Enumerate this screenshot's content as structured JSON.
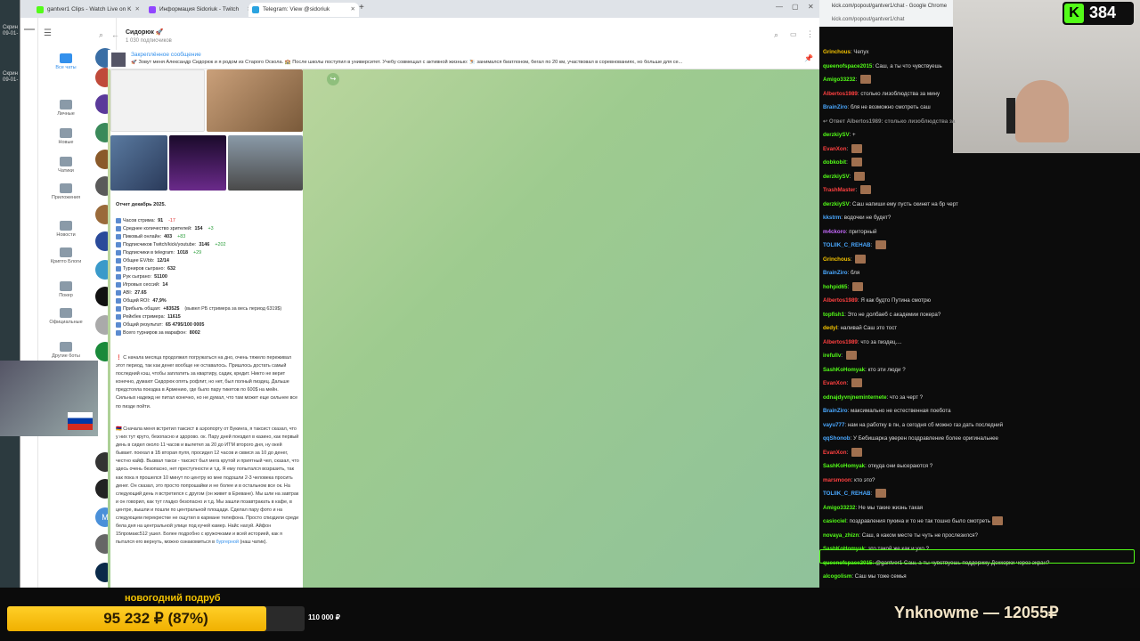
{
  "desktop": {
    "label1": "Скрин",
    "label2": "09-01-",
    "label3": "Скрин",
    "label4": "09-01-"
  },
  "browser": {
    "tabs": [
      {
        "label": "gantver1 Clips - Watch Live on K",
        "fav_color": "#53fc18"
      },
      {
        "label": "Информация Sidoriuk - Twitch",
        "fav_color": "#9146ff"
      },
      {
        "label": "Telegram: View @sidoriuk",
        "fav_color": "#2aa3e0"
      }
    ],
    "new_tab": "+",
    "win_min": "—",
    "win_max": "▢",
    "win_close": "✕"
  },
  "telegram": {
    "folders": [
      {
        "label": "Все чаты",
        "count": "90"
      },
      {
        "label": "Личные",
        "count": ""
      },
      {
        "label": "Новые",
        "count": "41"
      },
      {
        "label": "Чатики",
        "count": "1"
      },
      {
        "label": "Приложения",
        "count": ""
      },
      {
        "label": "Новости",
        "count": "6"
      },
      {
        "label": "Крипто Блоги",
        "count": "6"
      },
      {
        "label": "Покер",
        "count": "2"
      },
      {
        "label": "Официальные",
        "count": "6"
      },
      {
        "label": "Другие боты",
        "count": "5"
      }
    ],
    "channel_name": "Сидорюк 🚀",
    "subscribers": "1 030 подписчиков",
    "pinned_title": "Закреплённое сообщение",
    "pinned_text": "🚀 Зовут меня Александр Сидорюк и я родом из Старого Оскола. 🏫 После школы поступил в университет. Учебу совмещал с активной жизнью: ⛷️ занимался биатлоном, бегал по 20 км, участвовал в соревнованиях, но больше для се...",
    "report_title": "Отчет декабрь 2025.",
    "stats": [
      {
        "label": "Часов стрима:",
        "value": "91",
        "delta": "-17"
      },
      {
        "label": "Среднее количество зрителей:",
        "value": "154",
        "delta": "+3"
      },
      {
        "label": "Пиковый онлайн:",
        "value": "403",
        "delta": "+83"
      },
      {
        "label": "Подписчиков Twitch/kick/youtube:",
        "value": "3146",
        "delta": "+202"
      },
      {
        "label": "Подписчики в telegram:",
        "value": "1018",
        "delta": "+29"
      },
      {
        "label": "Общее EV/bb:",
        "value": "12/14",
        "delta": ""
      },
      {
        "label": "Турниров сыграно:",
        "value": "632",
        "delta": ""
      },
      {
        "label": "Рук сыграно:",
        "value": "51100",
        "delta": ""
      },
      {
        "label": "Игровых сессий:",
        "value": "14",
        "delta": ""
      },
      {
        "label": "ABI:",
        "value": "27.65",
        "delta": ""
      },
      {
        "label": "Общий ROI:",
        "value": "47,9%",
        "delta": ""
      },
      {
        "label": "Прибыль общая:",
        "value": "+8352$",
        "delta": "(вывел РБ стримера за весь период 6319$)"
      },
      {
        "label": "Рейкбек стримера:",
        "value": "11615",
        "delta": ""
      },
      {
        "label": "Общий результат:",
        "value": "65 4795/100 0005",
        "delta": ""
      },
      {
        "label": "Всего турниров за марафон:",
        "value": "8002",
        "delta": ""
      }
    ],
    "para1": "❗ С начала месяца продолжил погружаться на дно, очень тяжело переживал этот период, так как денег вообще не оставалось. Пришлось достать самый последний кэш, чтобы заплатить за квартиру, садик, кредит. Никто не верит конечно, думают Сидорюк опять рофлит, но нет, был полный пиздец. Дальше предстояла поездка в Армению, где было пару тикетов по 600$ на мейн. Сильных надежд не питал конечно, но не думал, что там может еще сильнее все по пизде пойти.",
    "para2": "🇦🇲 Сначала меня встретил таксист в аэропорту от Букинга, я таксист сказал, что у них тут круто, безопасно и здорово. ок. Пару дней поездил в казино, как первый день в сидел около 11 часов и вылетел за 20 до ИТМ второго дня, ну окей бывает. поехал в 1Б вторая пуля, просидел 12 часов и сквися за 10 до денег, честно кайф. Вызвал такси - таксист был мега крутой и приятный чел, сказал, что здесь очень безопасно, нет преступности и т.д. Я ему попытался возразить, так как пока я прошелся 10 минут по центру ко мне подошли 2-3 человека просить денег. Он сказал, это просто попрошайки и не более и в остальном все ок. На следующий день я встретился с другом (он живет в Ереване). Мы шли на завтрак и он говорил, как тут гладко безопасно и т.д. Мы зашли позавтракать в кафе, в центре, вышли и пошли по центральной площади. Сделал пару фото и на следующем перекрестке не ощутил в кармане телефона. Просто спиздили среди бела дня на центральной улице под кучей камер. Найс нахуй. Айфон 15промакс512 ушел. Более подробно с кружочками и всей историей, как я пытался его вернуть, можно ознакомиться в ",
    "para2_link": "бургерной",
    "para2_tail": " (наш чатик)."
  },
  "kick": {
    "window_title": "kick.com/popout/gantver1/chat - Google Chrome",
    "url": "kick.com/popout/gantver1/chat",
    "viewers": "384",
    "messages": [
      {
        "user": "Grinchous",
        "color": "#f5c400",
        "text": "Чепух"
      },
      {
        "user": "queenofspace2015",
        "color": "#53fc18",
        "text": "Саш, а ты что чувствуешь"
      },
      {
        "user": "Amigo33232",
        "color": "#53fc18",
        "text": "",
        "emote": true
      },
      {
        "user": "Albertos1989",
        "color": "#ff4040",
        "text": "столько лизоблюдства за мину"
      },
      {
        "user": "BrainZiro",
        "color": "#4aa8ff",
        "text": "бля не возможно смотреть саш"
      },
      {
        "user": "↩ Ответ Albertos1989: столько лизоблюдства за",
        "color": "#888",
        "text": ""
      },
      {
        "user": "derzkiySV",
        "color": "#53fc18",
        "text": "+"
      },
      {
        "user": "EvanXon",
        "color": "#ff4040",
        "text": "",
        "emote": true
      },
      {
        "user": "dobkobit",
        "color": "#53fc18",
        "text": "",
        "emote": true
      },
      {
        "user": "derzkiySV",
        "color": "#53fc18",
        "text": "",
        "emote": true
      },
      {
        "user": "TrashMaster",
        "color": "#ff4040",
        "text": "",
        "emote": true
      },
      {
        "user": "derzkiySV",
        "color": "#53fc18",
        "text": "Саш напиши ему пусть скинет на бр черт"
      },
      {
        "user": "kkstrm",
        "color": "#4aa8ff",
        "text": "водочки не будет?"
      },
      {
        "user": "m4ckoro",
        "color": "#c86bff",
        "text": "приторный"
      },
      {
        "user": "TOLIIK_C_REHAB",
        "color": "#4aa8ff",
        "text": "",
        "emote": true
      },
      {
        "user": "Grinchous",
        "color": "#f5c400",
        "text": "",
        "emote": true
      },
      {
        "user": "BrainZiro",
        "color": "#4aa8ff",
        "text": "бля"
      },
      {
        "user": "hohpid65",
        "color": "#53fc18",
        "text": "",
        "emote": true
      },
      {
        "user": "Albertos1989",
        "color": "#ff4040",
        "text": "Я как будто Путина смотрю"
      },
      {
        "user": "topfish1",
        "color": "#53fc18",
        "text": "Это не долбаеб с академии покера?"
      },
      {
        "user": "dedyl",
        "color": "#f5c400",
        "text": "наливай Саш это тост"
      },
      {
        "user": "Albertos1989",
        "color": "#ff4040",
        "text": "что за пиздец...."
      },
      {
        "user": "irefullv",
        "color": "#53fc18",
        "text": "",
        "emote": true
      },
      {
        "user": "SashKoHomyak",
        "color": "#53fc18",
        "text": "кто эти люди ?"
      },
      {
        "user": "EvanXon",
        "color": "#ff4040",
        "text": "",
        "emote": true
      },
      {
        "user": "odnajdyvnjneminternete",
        "color": "#53fc18",
        "text": "что за черт ?"
      },
      {
        "user": "BrainZiro",
        "color": "#4aa8ff",
        "text": "максимально не естественная поебота"
      },
      {
        "user": "vayu777",
        "color": "#4aa8ff",
        "text": "нам на работку в пн, а сегодня сб можно газ дать последний"
      },
      {
        "user": "qqShonob",
        "color": "#4aa8ff",
        "text": "У Бебишарка уверен поздравление более оригинальнее"
      },
      {
        "user": "EvanXon",
        "color": "#ff4040",
        "text": "",
        "emote": true
      },
      {
        "user": "SashKoHomyak",
        "color": "#53fc18",
        "text": "откуда они высераются ?"
      },
      {
        "user": "marsmoon",
        "color": "#ff4040",
        "text": "кто это?"
      },
      {
        "user": "TOLIIK_C_REHAB",
        "color": "#4aa8ff",
        "text": "",
        "emote": true
      },
      {
        "user": "Amigo33232",
        "color": "#53fc18",
        "text": "Не мы такие жизнь такая"
      },
      {
        "user": "casiociel",
        "color": "#53fc18",
        "text": "поздравления пукина и то не так тошно было смотреть",
        "emote": true
      },
      {
        "user": "novaya_zhizn",
        "color": "#53fc18",
        "text": "Саш, в каком месте ты чуть не прослезился?"
      },
      {
        "user": "SashKoHomyak",
        "color": "#53fc18",
        "text": "это такой же как и ухо ?"
      },
      {
        "user": "queenofspace2015",
        "color": "#53fc18",
        "text": "@gantver1 Саш, а ты чувствуешь поддержку Доккорки через экран?"
      },
      {
        "user": "alcogolism",
        "color": "#53fc18",
        "text": "Саш мы тоже семья"
      }
    ]
  },
  "overlay": {
    "goal_title": "новогодний подруб",
    "goal_progress": "95 232 ₽ (87%)",
    "goal_fraction": 0.87,
    "goal_target": "110 000 ₽",
    "top_donor": "Ynknowme — 12055₽"
  }
}
